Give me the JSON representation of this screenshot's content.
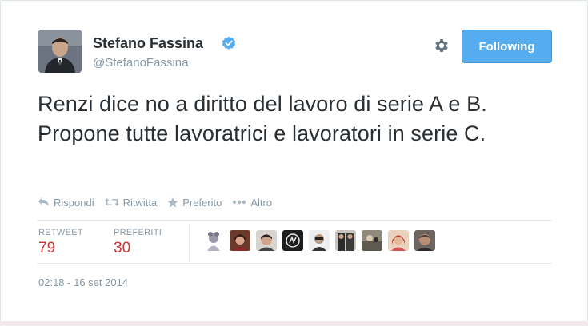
{
  "tweet": {
    "author_name": "Stefano Fassina",
    "author_handle": "@StefanoFassina",
    "follow_label": "Following",
    "text": "Renzi dice no a diritto del lavoro di serie A e B. Propone tutte lavoratrici e lavoratori in serie C.",
    "actions": {
      "reply": "Rispondi",
      "retweet": "Ritwitta",
      "favorite": "Preferito",
      "more": "Altro"
    },
    "stats": {
      "retweets_label": "RETWEET",
      "retweets_value": "79",
      "favorites_label": "PREFERITI",
      "favorites_value": "30"
    },
    "timestamp": "02:18 - 16 set 2014"
  },
  "colors": {
    "follow_button": "#55acee",
    "verified_badge": "#55acee",
    "stat_value": "#cc3333",
    "muted_text": "#8899a6"
  },
  "icons": {
    "settings": "gear-icon",
    "verified": "verified-badge-icon",
    "reply": "reply-icon",
    "retweet": "retweet-icon",
    "favorite": "star-icon",
    "more": "more-dots-icon"
  }
}
